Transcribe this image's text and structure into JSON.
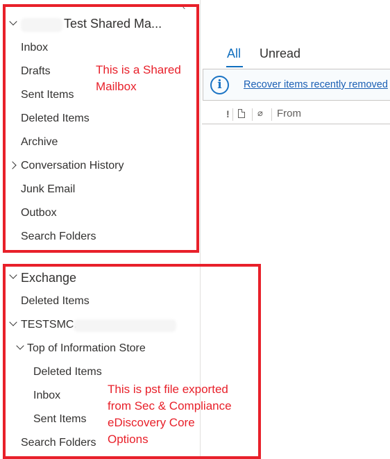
{
  "shared_mailbox": {
    "account_name": "Test Shared Ma...",
    "folders": [
      "Inbox",
      "Drafts",
      "Sent Items",
      "Deleted Items",
      "Archive",
      "Conversation History",
      "Junk Email",
      "Outbox",
      "Search Folders"
    ],
    "annotation": [
      "This is a Shared",
      "Mailbox"
    ]
  },
  "exchange": {
    "account_name": "Exchange",
    "deleted_items": "Deleted Items",
    "pst_name": "TESTSMC.",
    "top_store": "Top of Information Store",
    "store_folders": [
      "Deleted Items",
      "Inbox",
      "Sent Items"
    ],
    "search_folders": "Search Folders",
    "annotation": [
      "This is pst file exported",
      "from Sec & Compliance",
      "eDiscovery Core",
      "Options"
    ]
  },
  "message_list": {
    "tabs": {
      "all": "All",
      "unread": "Unread"
    },
    "info_icon": "info-icon",
    "recover_link": "Recover items recently removed",
    "columns": {
      "importance": "!",
      "icon_col": "document-icon",
      "attachment_col": "paperclip-icon",
      "from": "From"
    }
  },
  "colors": {
    "accent": "#106ebe",
    "annotation_red": "#e8202a",
    "link": "#1a5fb4"
  },
  "icons": {
    "collapse": "chevron-left-icon",
    "expand": "chevron-down-icon",
    "collapsed": "chevron-right-icon"
  }
}
